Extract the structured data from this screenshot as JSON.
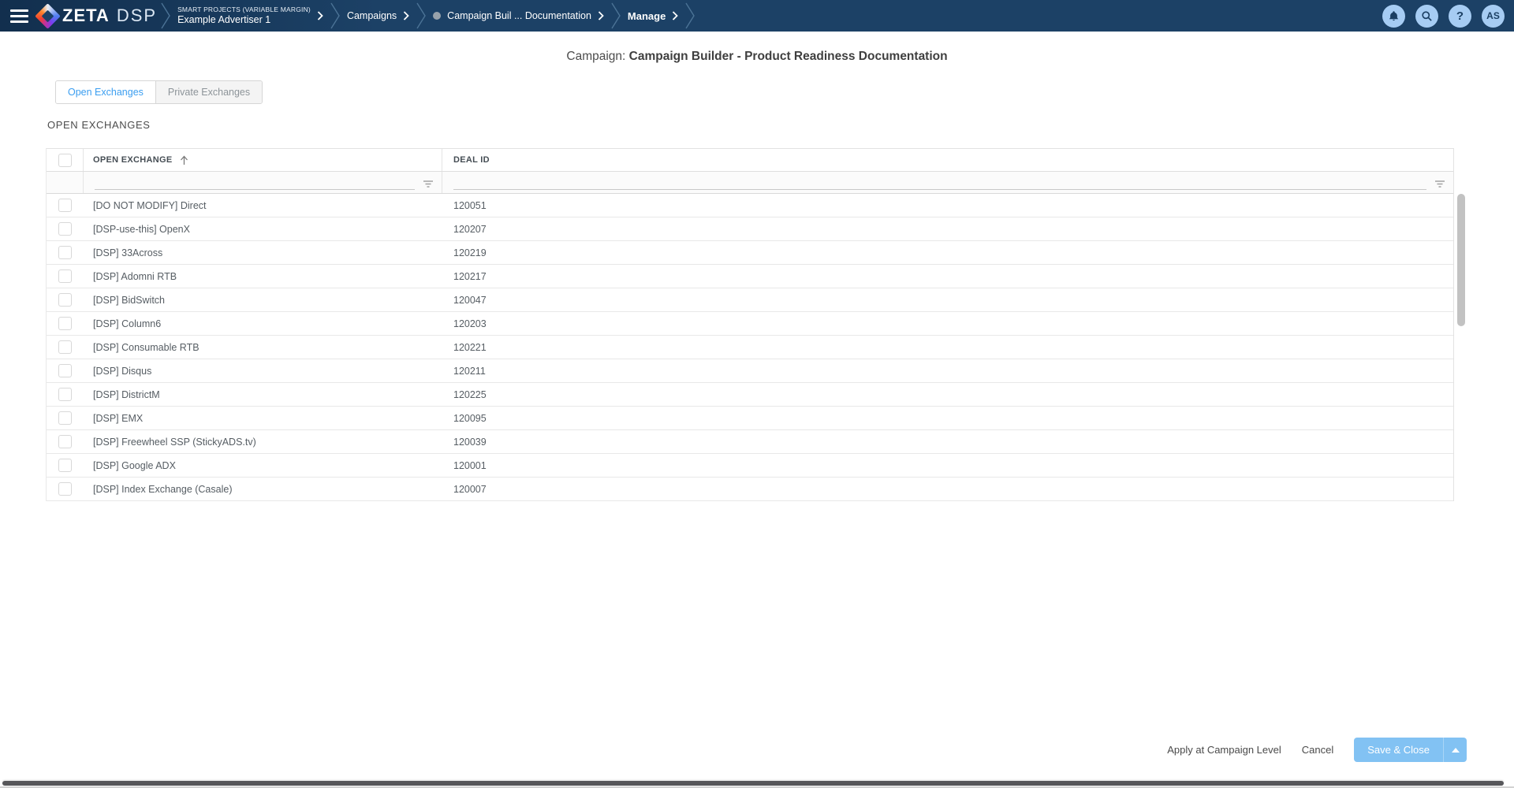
{
  "topbar": {
    "brand": {
      "zeta": "ZETA",
      "dsp": "DSP"
    },
    "breadcrumbs": [
      {
        "eyebrow": "SMART PROJECTS (VARIABLE MARGIN)",
        "label": "Example Advertiser 1"
      },
      {
        "label": "Campaigns"
      },
      {
        "label": "Campaign Buil ... Documentation",
        "has_status_dot": true
      },
      {
        "label": "Manage",
        "active": true
      }
    ],
    "icons": [
      "notifications-bell",
      "search",
      "help"
    ],
    "avatar_initials": "AS"
  },
  "header": {
    "title_prefix": "Campaign:",
    "title": "Campaign Builder - Product Readiness Documentation"
  },
  "tabs": [
    {
      "label": "Open Exchanges",
      "active": true
    },
    {
      "label": "Private Exchanges",
      "active": false
    }
  ],
  "section": {
    "heading": "OPEN EXCHANGES"
  },
  "table": {
    "columns": [
      "OPEN EXCHANGE",
      "DEAL ID"
    ],
    "sort": {
      "column": "OPEN EXCHANGE",
      "direction": "ascending"
    },
    "filter_row": {
      "exchange_filter_value": "",
      "dealid_filter_value": ""
    },
    "rows": [
      {
        "exchange": "[DO NOT MODIFY] Direct",
        "deal_id": "120051"
      },
      {
        "exchange": "[DSP-use-this] OpenX",
        "deal_id": "120207"
      },
      {
        "exchange": "[DSP] 33Across",
        "deal_id": "120219"
      },
      {
        "exchange": "[DSP] Adomni RTB",
        "deal_id": "120217"
      },
      {
        "exchange": "[DSP] BidSwitch",
        "deal_id": "120047"
      },
      {
        "exchange": "[DSP] Column6",
        "deal_id": "120203"
      },
      {
        "exchange": "[DSP] Consumable RTB",
        "deal_id": "120221"
      },
      {
        "exchange": "[DSP] Disqus",
        "deal_id": "120211"
      },
      {
        "exchange": "[DSP] DistrictM",
        "deal_id": "120225"
      },
      {
        "exchange": "[DSP] EMX",
        "deal_id": "120095"
      },
      {
        "exchange": "[DSP] Freewheel SSP (StickyADS.tv)",
        "deal_id": "120039"
      },
      {
        "exchange": "[DSP] Google ADX",
        "deal_id": "120001"
      },
      {
        "exchange": "[DSP] Index Exchange (Casale)",
        "deal_id": "120007"
      }
    ]
  },
  "footer": {
    "apply_label": "Apply at Campaign Level",
    "cancel_label": "Cancel",
    "save_label": "Save & Close"
  },
  "colors": {
    "topbar_navy": "#1c4166",
    "accent_blue": "#3b9ef0",
    "save_button_blue": "#82c2f3",
    "icon_circle_blue": "#a6ccf3"
  }
}
